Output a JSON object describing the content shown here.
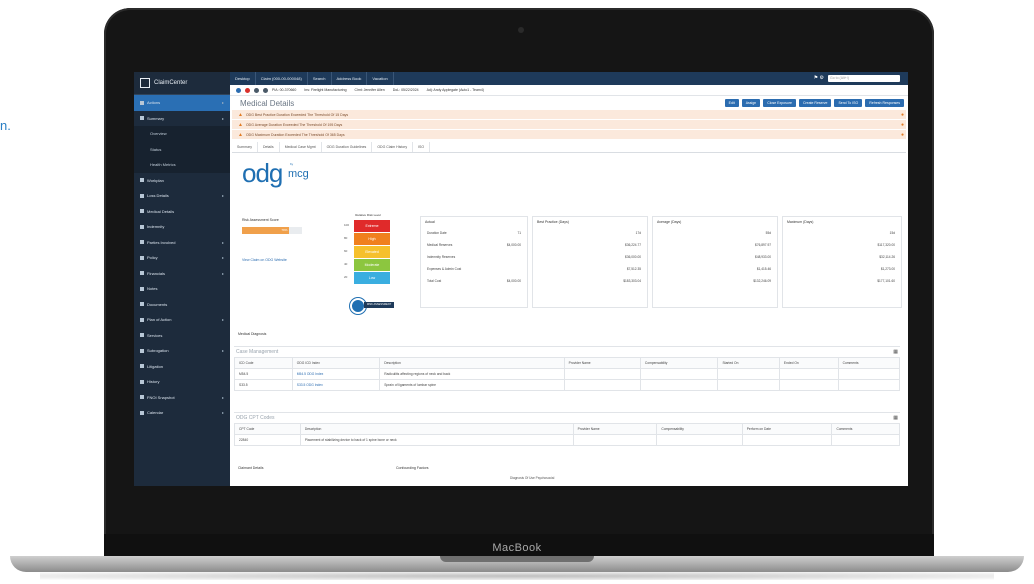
{
  "edge_text": "n.",
  "device": {
    "brand": "MacBook"
  },
  "app": {
    "name": "ClaimCenter",
    "topbar": [
      "Desktop",
      "Claim (000-00-000048)",
      "Search",
      "Address Book",
      "Vacation"
    ],
    "search_placeholder": "Go to (Alt+/)",
    "info": [
      "PIA: 00-370660",
      "Ins: Firelight Manufacturing",
      "Clmt: Jennifer Allen",
      "DoL: 05/22/2024",
      "Adj: Andy Applegate (Auto1 - Team4)"
    ],
    "page_title": "Medical Details",
    "actions": [
      "Edit",
      "Assign",
      "Close Exposure",
      "Create Reserve",
      "Send To ISO",
      "Refresh Responses"
    ],
    "alerts": [
      "ODG Best Practice Duration Exceeded The Threshold Of 15 Days",
      "ODG Average Duration Exceeded The Threshold Of 195 Days",
      "ODG Maximum Duration Exceeded The Threshold Of 365 Days"
    ],
    "tabs": [
      "Summary",
      "Details",
      "Medical Case Mgmt",
      "ODG Duration Guidelines",
      "ODG Claim History",
      "ISO"
    ],
    "sidebar": {
      "items": [
        {
          "label": "Actions",
          "active": true
        },
        {
          "label": "Summary"
        },
        {
          "label": "Overview",
          "sub": true
        },
        {
          "label": "Status",
          "sub": true
        },
        {
          "label": "Health Metrics",
          "sub": true
        },
        {
          "label": "Workplan"
        },
        {
          "label": "Loss Details"
        },
        {
          "label": "Medical Details"
        },
        {
          "label": "Indemnity"
        },
        {
          "label": "Parties Involved"
        },
        {
          "label": "Policy"
        },
        {
          "label": "Financials"
        },
        {
          "label": "Notes"
        },
        {
          "label": "Documents"
        },
        {
          "label": "Plan of Action"
        },
        {
          "label": "Services"
        },
        {
          "label": "Subrogation"
        },
        {
          "label": "Litigation"
        },
        {
          "label": "History"
        },
        {
          "label": "FNOI Snapshot"
        },
        {
          "label": "Calendar"
        }
      ]
    },
    "odg": {
      "logo": "odg",
      "logo_sub": "by",
      "logo_mcg": "mcg",
      "risk_label": "Risk Assessment Score",
      "risk_value": "79%",
      "risk_fraction": 0.79,
      "risk_link": "View Claim on ODG Website",
      "gauge_title": "Relative Risk Level",
      "gauge_levels": [
        "Extreme",
        "High",
        "Elevated",
        "Moderate",
        "Low"
      ],
      "gauge_colors": [
        "#e02a2a",
        "#f0801e",
        "#f6c02c",
        "#8cc63f",
        "#3aaee0"
      ],
      "gauge_ticks": [
        "100",
        "80",
        "60",
        "40",
        "20"
      ],
      "gauge_caption": "RISK ASSESSMENT SCORE"
    },
    "panels": {
      "actual": {
        "title": "Actual",
        "rows": [
          [
            "Duration Date",
            "71"
          ],
          [
            "Medical Reserves",
            "$4,000.00"
          ],
          [
            "Indemnity Reserves",
            ""
          ],
          [
            "Expenses & Admin Cost",
            ""
          ],
          [
            "Total Cost",
            "$4,000.00"
          ]
        ]
      },
      "best": {
        "title": "Best Practice (Days)",
        "rows": [
          "17d",
          "$36,224.77",
          "$36,000.00",
          "$7,512.35",
          "$183,303.04"
        ]
      },
      "avg": {
        "title": "Average (Days)",
        "rows": [
          "55d",
          "$76,897.97",
          "$48,933.00",
          "$1,415.46",
          "$132,246.09"
        ]
      },
      "max": {
        "title": "Maximum (Days)",
        "rows": [
          "15d",
          "$117,320.00",
          "$32,114.26",
          "$1,273.00",
          "$177,101.60"
        ]
      }
    },
    "medical_diagnosis_label": "Medical Diagnosis",
    "case_mgmt": {
      "title": "Case Management",
      "headers": [
        "ICD Code",
        "ODG ICD Index",
        "Description",
        "Provider Name",
        "Compensability",
        "Started On",
        "Ended On",
        "Comments"
      ],
      "rows": [
        [
          "M54.5",
          "M54.5 ODG Index",
          "Radiculitis affecting regions of neck and back",
          "",
          "",
          "",
          "",
          ""
        ],
        [
          "S33.5",
          "S33.5 ODG Index",
          "Sprain of ligaments of lumbar spine",
          "",
          "",
          "",
          "",
          ""
        ]
      ]
    },
    "cpt": {
      "title": "ODG CPT Codes",
      "headers": [
        "CPT Code",
        "Description",
        "Provider Name",
        "Compensability",
        "Perform on Date",
        "Comments"
      ],
      "rows": [
        [
          "22840",
          "Placement of stabilizing device to back of 1 spine bone or neck",
          "",
          "",
          "",
          ""
        ]
      ]
    },
    "footer": {
      "claimant_details": "Claimant Details",
      "confounding_factors": "Confounding Factors",
      "psychosocial": "Diagnosis Of Use Psychosocial"
    }
  }
}
